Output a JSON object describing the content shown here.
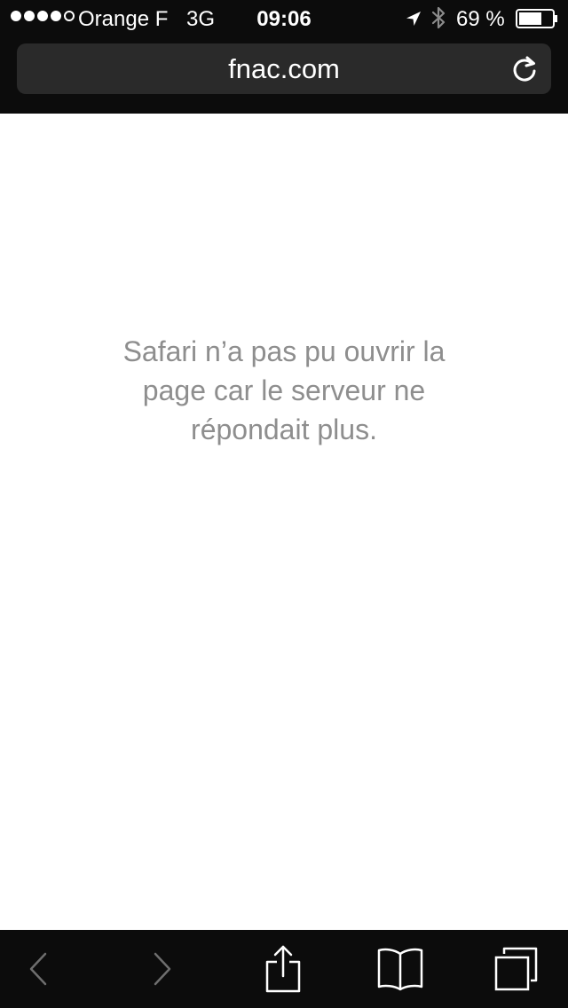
{
  "status_bar": {
    "carrier": "Orange F",
    "network": "3G",
    "time": "09:06",
    "battery_percent": "69 %",
    "battery_level": 0.69,
    "signal_bars_filled": 4,
    "signal_bars_total": 5,
    "icons": [
      "location-arrow-icon",
      "bluetooth-icon",
      "battery-icon"
    ]
  },
  "address_bar": {
    "url": "fnac.com",
    "reload_icon": "reload-icon"
  },
  "page": {
    "error_message": "Safari n’a pas pu ouvrir la page car le serveur ne répondait plus."
  },
  "toolbar": {
    "buttons": [
      {
        "name": "back",
        "icon": "chevron-left-icon",
        "enabled": false
      },
      {
        "name": "forward",
        "icon": "chevron-right-icon",
        "enabled": false
      },
      {
        "name": "share",
        "icon": "share-icon",
        "enabled": true
      },
      {
        "name": "bookmarks",
        "icon": "book-icon",
        "enabled": true
      },
      {
        "name": "tabs",
        "icon": "tabs-icon",
        "enabled": true
      }
    ]
  },
  "colors": {
    "chrome_background": "#0c0c0c",
    "url_field_background": "#2a2a2a",
    "message_text": "#8e8e8e",
    "disabled_icon": "#6e6e6e",
    "active_icon": "#ffffff"
  }
}
